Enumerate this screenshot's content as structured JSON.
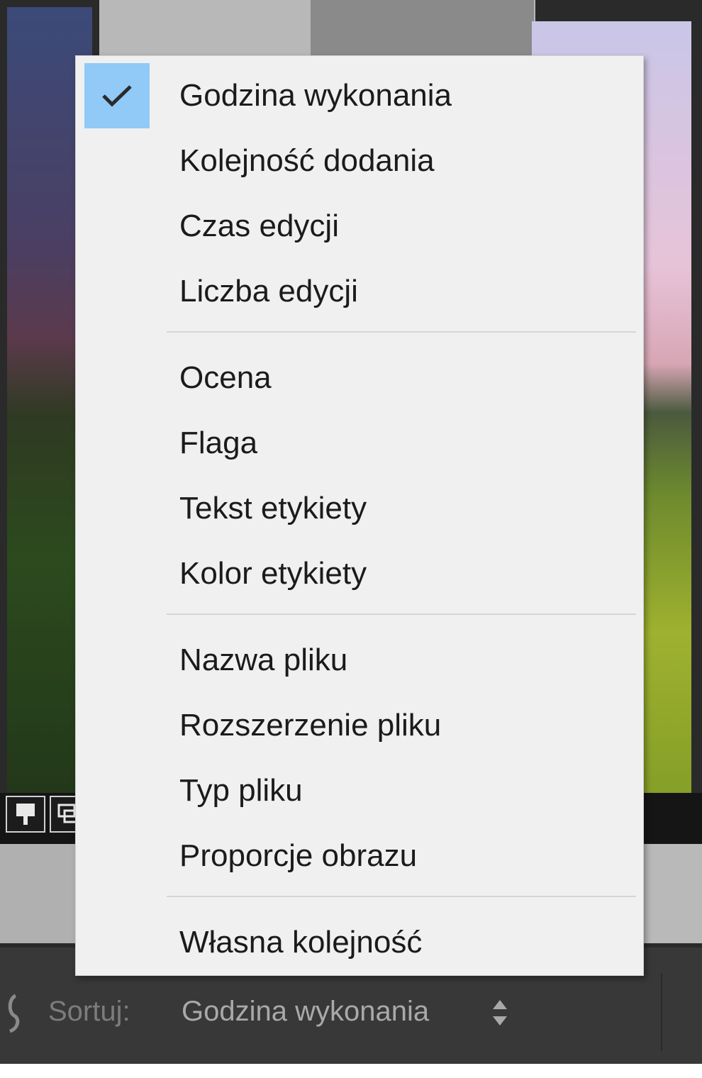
{
  "menu": {
    "groups": [
      {
        "items": [
          {
            "label": "Godzina wykonania",
            "checked": true
          },
          {
            "label": "Kolejność dodania",
            "checked": false
          },
          {
            "label": "Czas edycji",
            "checked": false
          },
          {
            "label": "Liczba edycji",
            "checked": false
          }
        ]
      },
      {
        "items": [
          {
            "label": "Ocena",
            "checked": false
          },
          {
            "label": "Flaga",
            "checked": false
          },
          {
            "label": "Tekst etykiety",
            "checked": false
          },
          {
            "label": "Kolor etykiety",
            "checked": false
          }
        ]
      },
      {
        "items": [
          {
            "label": "Nazwa pliku",
            "checked": false
          },
          {
            "label": "Rozszerzenie pliku",
            "checked": false
          },
          {
            "label": "Typ pliku",
            "checked": false
          },
          {
            "label": "Proporcje obrazu",
            "checked": false
          }
        ]
      },
      {
        "items": [
          {
            "label": "Własna kolejność",
            "checked": false
          }
        ]
      }
    ]
  },
  "toolbar": {
    "sort_label": "Sortuj:",
    "sort_value": "Godzina wykonania"
  },
  "icons": {
    "check": "check-icon",
    "sort_arrows": "up-down-arrows-icon",
    "sort_direction": "sort-direction-icon",
    "thumb_flag": "flag-icon",
    "thumb_copy": "copy-icon"
  },
  "colors": {
    "menu_bg": "#f0f0f0",
    "check_highlight": "#91c9f7",
    "toolbar_bg": "#383838"
  }
}
